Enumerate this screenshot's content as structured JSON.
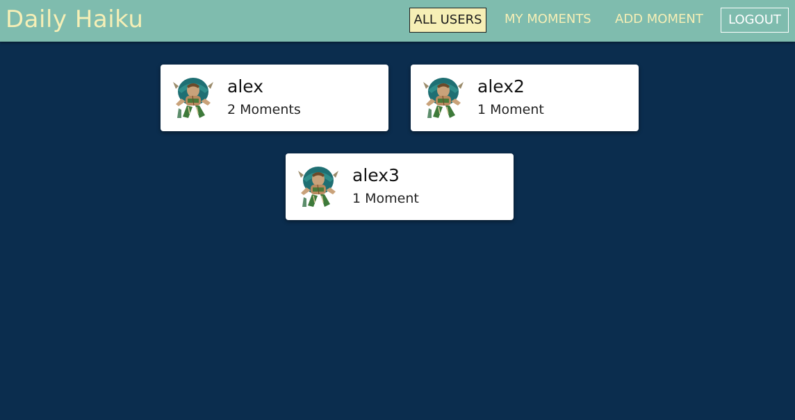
{
  "app": {
    "brand": "Daily Haiku"
  },
  "nav": {
    "items": [
      {
        "label": "ALL USERS",
        "active": true
      },
      {
        "label": "MY MOMENTS",
        "active": false
      },
      {
        "label": "ADD MOMENT",
        "active": false
      },
      {
        "label": "LOGOUT",
        "active": false
      }
    ]
  },
  "users": [
    {
      "name": "alex",
      "moments": "2 Moments",
      "avatar_icon": "warrior-avatar-icon"
    },
    {
      "name": "alex2",
      "moments": "1 Moment",
      "avatar_icon": "warrior-avatar-icon"
    },
    {
      "name": "alex3",
      "moments": "1 Moment",
      "avatar_icon": "warrior-avatar-icon"
    }
  ],
  "colors": {
    "navbar": "#7fbcae",
    "accent": "#f6efb6",
    "background": "#0b2d4e",
    "card": "#ffffff"
  }
}
